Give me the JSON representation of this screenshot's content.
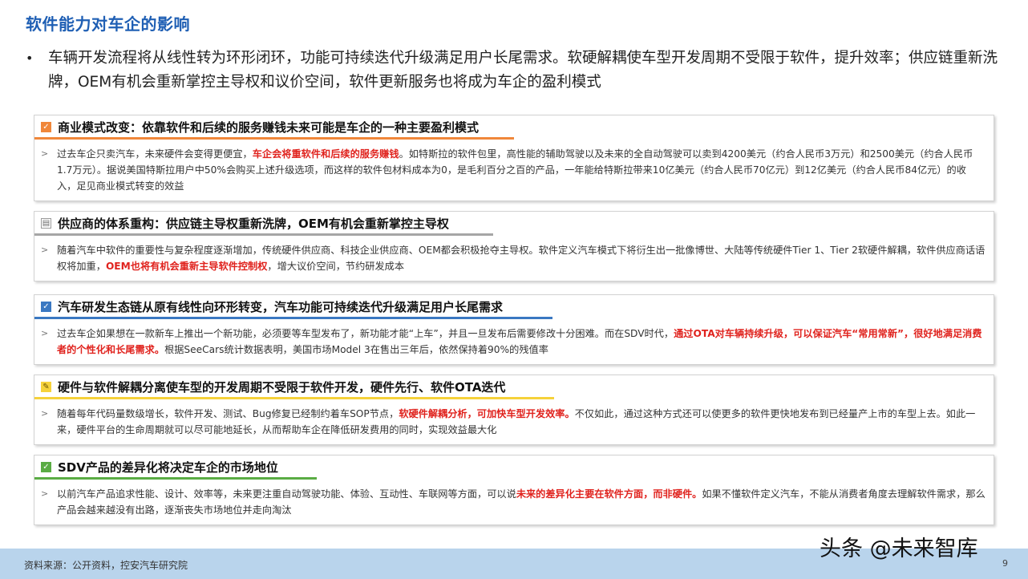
{
  "page": {
    "title": "软件能力对车企的影响",
    "intro": "车辆开发流程将从线性转为环形闭环，功能可持续迭代升级满足用户长尾需求。软硬解耦使车型开发周期不受限于软件，提升效率；供应链重新洗牌，OEM有机会重新掌控主导权和议价空间，软件更新服务也将成为车企的盈利模式"
  },
  "colors": {
    "title": "#1f5fb4",
    "highlight": "#e0231e"
  },
  "cards": [
    {
      "title": "商业模式改变：依靠软件和后续的服务赚钱未来可能是车企的一种主要盈利模式",
      "icon": "checkbox-icon",
      "accent": "#f0873a",
      "segments": [
        {
          "text": "过去车企只卖汽车，未来硬件会变得更便宜，"
        },
        {
          "text": "车企会将重软件和后续的服务赚钱",
          "hl": true
        },
        {
          "text": "。如特斯拉的软件包里，高性能的辅助驾驶以及未来的全自动驾驶可以卖到4200美元（约合人民币3万元）和2500美元（约合人民币1.7万元）。据说美国特斯拉用户中50%会购买上述升级选项，而这样的软件包材料成本为0，是毛利百分之百的产品，一年能给特斯拉带来10亿美元（约合人民币70亿元）到12亿美元（约合人民币84亿元）的收入，足见商业模式转变的效益"
        }
      ]
    },
    {
      "title": "供应商的体系重构：供应链主导权重新洗牌，OEM有机会重新掌控主导权",
      "icon": "chart-icon",
      "accent": "#a6a6a6",
      "segments": [
        {
          "text": "随着汽车中软件的重要性与复杂程度逐渐增加，传统硬件供应商、科技企业供应商、OEM都会积极抢夺主导权。软件定义汽车模式下将衍生出一批像博世、大陆等传统硬件Tier 1、Tier 2软硬件解耦，软件供应商话语权将加重，"
        },
        {
          "text": "OEM也将有机会重新主导软件控制权",
          "hl": true
        },
        {
          "text": "，增大议价空间，节约研发成本"
        }
      ]
    },
    {
      "title": "汽车研发生态链从原有线性向环形转变，汽车功能可持续迭代升级满足用户长尾需求",
      "icon": "checkbox-icon",
      "accent": "#3a78c2",
      "segments": [
        {
          "text": "过去车企如果想在一款新车上推出一个新功能，必须要等车型发布了，新功能才能“上车”，并且一旦发布后需要修改十分困难。而在SDV时代，"
        },
        {
          "text": "通过OTA对车辆持续升级，可以保证汽车“常用常新”，很好地满足消费者的个性化和长尾需求。",
          "hl": true
        },
        {
          "text": "根据SeeCars统计数据表明，美国市场Model 3在售出三年后，依然保持着90%的残值率"
        }
      ]
    },
    {
      "title": "硬件与软件解耦分离使车型的开发周期不受限于软件开发，硬件先行、软件OTA迭代",
      "icon": "pencil-icon",
      "accent": "#f6d23a",
      "segments": [
        {
          "text": "随着每年代码量数级增长，软件开发、测试、Bug修复已经制约着车SOP节点，"
        },
        {
          "text": "软硬件解耦分析，可加快车型开发效率。",
          "hl": true
        },
        {
          "text": "不仅如此，通过这种方式还可以使更多的软件更快地发布到已经量产上市的车型上去。如此一来，硬件平台的生命周期就可以尽可能地延长，从而帮助车企在降低研发费用的同时，实现效益最大化"
        }
      ]
    },
    {
      "title": "SDV产品的差异化将决定车企的市场地位",
      "icon": "checkbox-icon",
      "accent": "#5aac44",
      "segments": [
        {
          "text": "以前汽车产品追求性能、设计、效率等，未来更注重自动驾驶功能、体验、互动性、车联网等方面，可以说"
        },
        {
          "text": "未来的差异化主要在软件方面，而非硬件。",
          "hl": true
        },
        {
          "text": "如果不懂软件定义汽车，不能从消费者角度去理解软件需求，那么产品会越来越没有出路，逐渐丧失市场地位并走向淘汰"
        }
      ]
    }
  ],
  "footer": {
    "source": "资料来源：公开资料，控安汽车研究院",
    "watermark": "头条 @未来智库",
    "page_number": "9"
  }
}
